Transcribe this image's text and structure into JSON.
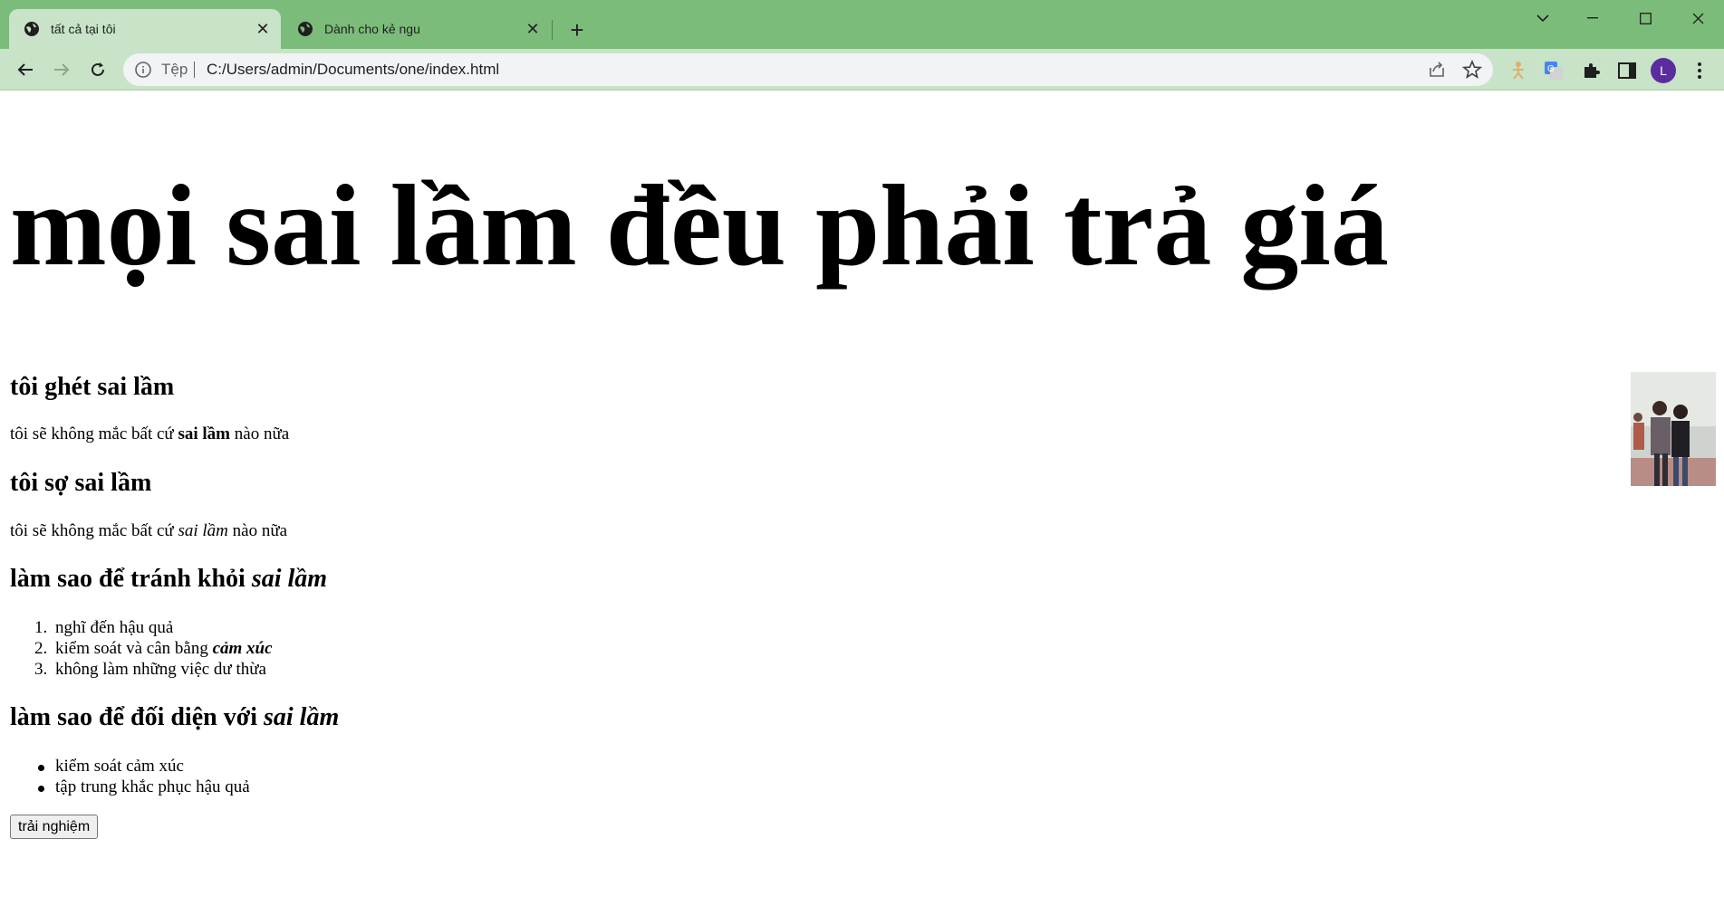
{
  "browser": {
    "tabs": [
      {
        "title": "tất cả tại tôi",
        "active": true
      },
      {
        "title": "Dành cho kẻ ngu",
        "active": false
      }
    ],
    "address": {
      "scheme_label": "Tệp",
      "url": "C:/Users/admin/Documents/one/index.html"
    },
    "profile_initial": "L",
    "colors": {
      "frame": "#7bbc7b",
      "toolbar": "#c8e3c8",
      "avatar": "#5a2ca0"
    }
  },
  "page": {
    "title": "mọi sai lầm đều phải trả giá",
    "section1": {
      "heading": "tôi ghét sai lầm",
      "text_before": "tôi sẽ không mắc bất cứ ",
      "text_bold": "sai lầm",
      "text_after": " nào nữa"
    },
    "section2": {
      "heading": "tôi sợ sai lầm",
      "text_before": "tôi sẽ không mắc bất cứ ",
      "text_italic": "sai lầm",
      "text_after": " nào nữa"
    },
    "section3": {
      "heading_before": "làm sao để tránh khỏi ",
      "heading_italic": "sai lầm",
      "items": [
        {
          "text": "nghĩ đến hậu quả",
          "emphasis": ""
        },
        {
          "text": "kiểm soát và cân bằng ",
          "emphasis": "cảm xúc"
        },
        {
          "text": "không làm những việc dư thừa",
          "emphasis": ""
        }
      ]
    },
    "section4": {
      "heading_before": "làm sao để đối diện với ",
      "heading_italic": "sai lầm",
      "items": [
        "kiểm soát cảm xúc",
        "tập trung khắc phục hậu quả"
      ]
    },
    "button_label": "trải nghiệm"
  }
}
